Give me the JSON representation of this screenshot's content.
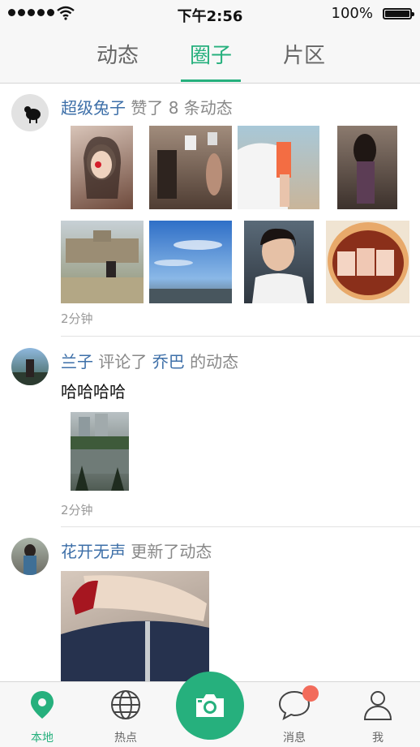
{
  "status_bar": {
    "time": "下午2:56",
    "battery_percent": "100%",
    "battery_level": 1.0
  },
  "tabs": [
    {
      "label": "动态"
    },
    {
      "label": "圈子",
      "active": true
    },
    {
      "label": "片区"
    }
  ],
  "feed": [
    {
      "user": "超级兔子",
      "action": "赞了 8 条动态",
      "time": "2分钟",
      "photo_count": 8
    },
    {
      "user": "兰子",
      "action_pre": "评论了",
      "target_user": "乔巴",
      "action_post": "的动态",
      "text": "哈哈哈哈",
      "time": "2分钟"
    },
    {
      "user": "花开无声",
      "action": "更新了动态"
    }
  ],
  "bottom_nav": [
    {
      "label": "本地",
      "icon": "location-pin-icon",
      "active": true
    },
    {
      "label": "热点",
      "icon": "globe-icon"
    },
    {
      "label": "",
      "icon": "camera-icon"
    },
    {
      "label": "消息",
      "icon": "chat-bubble-icon",
      "badge": true
    },
    {
      "label": "我",
      "icon": "person-icon"
    }
  ],
  "colors": {
    "accent": "#26b07d",
    "username": "#3d6fa8",
    "badge": "#f26b5b"
  }
}
